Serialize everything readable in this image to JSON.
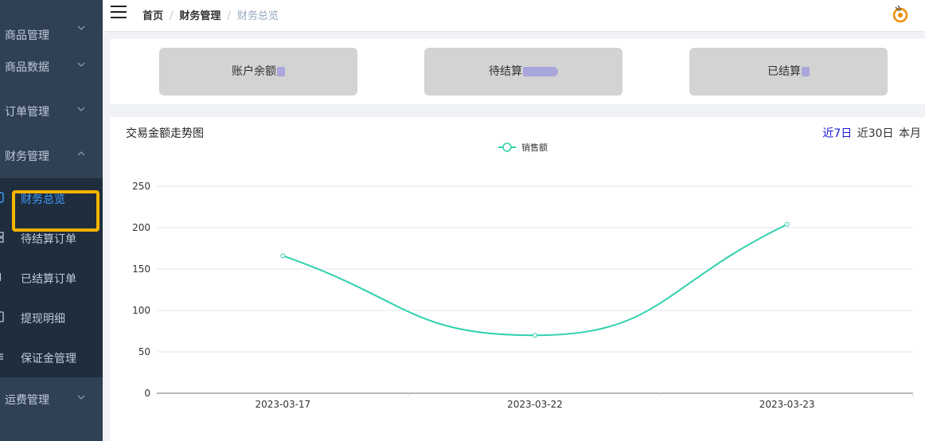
{
  "sidebar": {
    "items": [
      {
        "label": "商品管理"
      },
      {
        "label": "商品数据"
      },
      {
        "label": "订单管理"
      },
      {
        "label": "财务管理"
      }
    ],
    "sub_items": [
      {
        "label": "财务总览"
      },
      {
        "label": "待结算订单"
      },
      {
        "label": "已结算订单"
      },
      {
        "label": "提现明细"
      },
      {
        "label": "保证金管理"
      }
    ],
    "bottom_item": {
      "label": "运费管理"
    }
  },
  "header": {
    "breadcrumb": [
      "首页",
      "财务管理",
      "财务总览"
    ]
  },
  "stats": [
    {
      "label": "账户余额"
    },
    {
      "label": "待结算"
    },
    {
      "label": "已结算"
    }
  ],
  "panel": {
    "title": "交易金额走势图",
    "range_options": [
      "近7日",
      "近30日",
      "本月"
    ],
    "active_range": "近7日"
  },
  "chart_data": {
    "type": "line",
    "x": [
      "2023-03-17",
      "2023-03-22",
      "2023-03-23"
    ],
    "series": [
      {
        "name": "销售额",
        "values": [
          166,
          70,
          204
        ],
        "color": "#2fd1ad",
        "smooth": true
      }
    ],
    "ylim": [
      0,
      250
    ],
    "yticks": [
      0,
      50,
      100,
      150,
      200,
      250
    ],
    "grid": true,
    "legend": "top-center"
  }
}
